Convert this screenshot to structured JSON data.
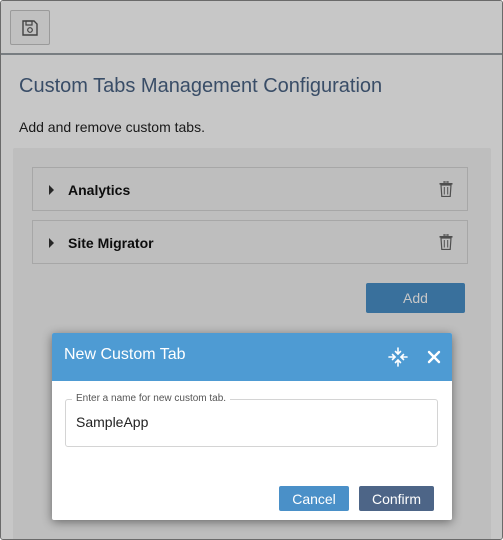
{
  "toolbar": {
    "save_icon": "save-icon"
  },
  "page": {
    "title": "Custom Tabs Management Configuration",
    "description": "Add and remove custom tabs."
  },
  "tabs": [
    {
      "label": "Analytics",
      "expand_icon": "caret-right-icon",
      "delete_icon": "trash-icon"
    },
    {
      "label": "Site Migrator",
      "expand_icon": "caret-right-icon",
      "delete_icon": "trash-icon"
    }
  ],
  "add_button": {
    "label": "Add"
  },
  "dialog": {
    "title": "New Custom Tab",
    "move_icon": "move-icon",
    "close_icon": "close-icon",
    "field_label": "Enter a name for new custom tab.",
    "field_value": "SampleApp",
    "cancel_label": "Cancel",
    "confirm_label": "Confirm"
  },
  "colors": {
    "accent": "#4e9bd3",
    "title_text": "#4a6385",
    "confirm_button": "#4d6587"
  }
}
